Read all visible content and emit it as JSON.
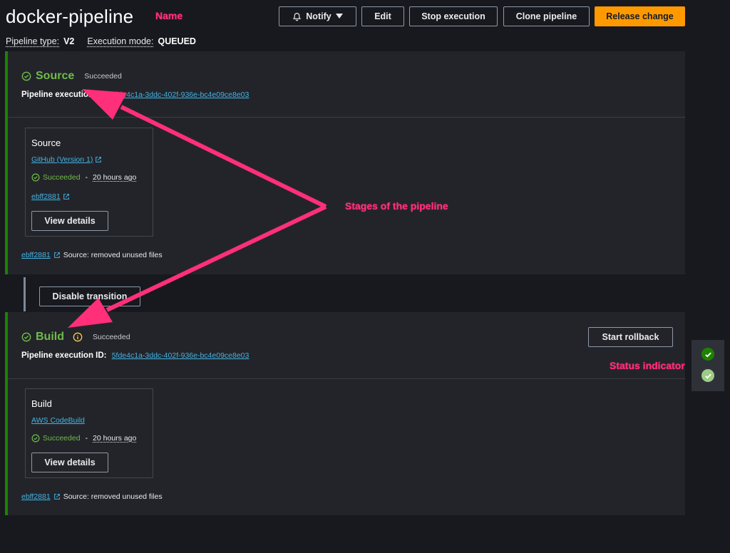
{
  "header": {
    "title": "docker-pipeline",
    "pipeline_type_label": "Pipeline type:",
    "pipeline_type_value": "V2",
    "execution_mode_label": "Execution mode:",
    "execution_mode_value": "QUEUED",
    "buttons": {
      "notify": "Notify",
      "edit": "Edit",
      "stop": "Stop execution",
      "clone": "Clone pipeline",
      "release": "Release change"
    }
  },
  "stages": [
    {
      "name": "Source",
      "status": "Succeeded",
      "execution_label": "Pipeline execution ID:",
      "execution_id": "5fde4c1a-3ddc-402f-936e-bc4e09ce8e03",
      "action": {
        "title": "Source",
        "provider": "GitHub (Version 1)",
        "status": "Succeeded",
        "time": "20 hours ago",
        "commit": "ebff2881",
        "details_button": "View details"
      },
      "commit": "ebff2881",
      "commit_message": "Source: removed unused files"
    },
    {
      "name": "Build",
      "status": "Succeeded",
      "execution_label": "Pipeline execution ID:",
      "execution_id": "5fde4c1a-3ddc-402f-936e-bc4e09ce8e03",
      "rollback_button": "Start rollback",
      "action": {
        "title": "Build",
        "provider": "AWS CodeBuild",
        "status": "Succeeded",
        "time": "20 hours ago",
        "details_button": "View details"
      },
      "commit": "ebff2881",
      "commit_message": "Source: removed unused files"
    }
  ],
  "transition": {
    "button": "Disable transition"
  },
  "annotations": {
    "name": "Name",
    "stages": "Stages of the pipeline",
    "status": "Status indicator"
  },
  "colors": {
    "success": "#6fbb4a",
    "primary": "#ff9900",
    "link": "#42b4e6",
    "annotation": "#ff2f79"
  }
}
